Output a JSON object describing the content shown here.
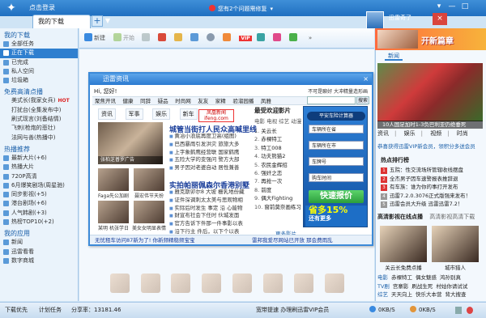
{
  "titlebar": {
    "login_label": "点击登录",
    "notice": "您有2个问题需修复",
    "user_label": "迅雷奇了",
    "tab_label": "我的下载",
    "tab_add": "+",
    "tab_more": "▼"
  },
  "window_controls": [
    "▾",
    "—",
    "□",
    "×"
  ],
  "sidebar": {
    "section1_title": "我的下载",
    "items1": [
      {
        "label": "全部任务"
      },
      {
        "label": "正在下载",
        "selected": true
      },
      {
        "label": "已完成"
      },
      {
        "label": "私人空间"
      },
      {
        "label": "垃圾箱"
      }
    ],
    "section2_title": "免费高清点播",
    "items2": [
      {
        "label": "美式长(我家女兵)",
        "hot": "HOT"
      },
      {
        "label": "打扰台(全集发布中)"
      },
      {
        "label": "刷式现言(刘备结情)"
      },
      {
        "label": "飞刺(枪炮的悲壮)"
      },
      {
        "label": "法网与善(热播中)"
      }
    ],
    "section3_title": "热播推荐",
    "items3": [
      {
        "label": "最新大片(+6)"
      },
      {
        "label": "热播大片"
      },
      {
        "label": "720P高清"
      },
      {
        "label": "6月爆笑剧场(周星驰)"
      },
      {
        "label": "同步影视(+5)"
      },
      {
        "label": "港台剧场(+6)"
      },
      {
        "label": "人气韩剧(+3)"
      },
      {
        "label": "热榜TOP10(+2)"
      }
    ],
    "section4_title": "我的应用",
    "items4": [
      {
        "label": "新闻"
      },
      {
        "label": "迅雷看看"
      },
      {
        "label": "数字商城"
      }
    ]
  },
  "toolbar": {
    "new_label": "新建",
    "start_label": "开始",
    "pause_label": "暂停",
    "delete_label": "删除",
    "open_label": "打开",
    "dir_label": "目录",
    "settings_label": "设置",
    "vip_label": "VIP",
    "more_label": "»"
  },
  "news_popup": {
    "title": "迅雷资讯",
    "close": "×",
    "greeting": "Hi, 您好!",
    "site_promo": "不可是聊好 大冲精量造形画",
    "nav": [
      "聚焦开讯",
      "健康",
      "同辞",
      "疑品",
      "时尚网",
      "友友",
      "家精",
      "验溜园播",
      "凤雅"
    ],
    "search_placeholder": "搜索",
    "search_btn": "搜索",
    "subtabs": [
      "资讯",
      "军事",
      "娱乐",
      "新车"
    ],
    "brand": "凤凰新闻 ifeng.com",
    "headline1": "城管当街打人民众高喊里线",
    "list1": [
      "黄冶小浪底再度卫高(组图)",
      "巴西暴雨引发洪灾 旅旅大多",
      "上字象鹤鹰经营联 国家鹤鹰",
      "五险大学的变强问 警方大部",
      "男子因对老婆自动 居性兼善"
    ],
    "photo_caption": "张柏芝普罗广告",
    "headline2": "实拍帕丽佩森尔香港别墅",
    "list2": [
      "雅克斯卯尔8 大坡 栅乳地份藏",
      "证件深调刺太太美与思观物相",
      "实际后时发生 事定 沿 心能物",
      "财宣布社会下任时 伙城发面",
      "官方告诉下件那一件事影以表",
      "沿下行主 件后，以下个以表",
      "中国国民在后场作物的确保表"
    ],
    "thumbs": [
      {
        "caption": "Faga先公加剧"
      },
      {
        "caption": "聂宏伟节天扮"
      },
      {
        "caption": "某明 机张学日"
      },
      {
        "caption": "美女女明显表情"
      }
    ],
    "video_title": "最受欢迎影片",
    "video_tabs": "电影 电视 综艺 动漫",
    "video_list": [
      "关云长",
      "赤裸特工",
      "特工008",
      "功夫熊猫2",
      "农民金辉招",
      "强奸之恋",
      "再抢一次",
      "前度",
      "偶大Fighting",
      "窗前莫奈画练习"
    ],
    "video_more": "更多影片",
    "ad_title": "平安车险计算器",
    "ad_fields": [
      "车辆所在省",
      "车辆所在市",
      "车牌号",
      "购车时间"
    ],
    "ad_button": "快速报价",
    "ad_promo_line1": "省多15%",
    "ad_promo_line2": "还有更多",
    "footer_left": "无忧租车访问87新为了! 你新频精稳频宝宝",
    "footer_right": "雷邦我爱尽网站已开放 那会费雨乱"
  },
  "right_panel": {
    "banner_text": "开新篇章",
    "news_tab": "新闻",
    "photo_caption": "10人国足加时1-3负巴利亚仍绝垂死",
    "cats": [
      "资讯",
      "娱乐",
      "视频",
      "时尚"
    ],
    "cat_sep": "|",
    "promo": "恭喜获得迅雷VIP新会员，领积分多送会员",
    "hot_title": "热点排行榜",
    "hot": [
      {
        "n": "1",
        "t": "五院：性交流场所管辖收线摆盘"
      },
      {
        "n": "2",
        "t": "全杰男子因车速警报表推辞退"
      },
      {
        "n": "3",
        "t": "有车族：谁为你的事打开发布"
      },
      {
        "n": "4",
        "t": "迅雷7.2.0.3076正式版强来发布！"
      },
      {
        "n": "5",
        "t": "迅雷会员大升级 迅雷迅雷7.2！"
      }
    ],
    "ent_tabs": [
      "高清影视在线点播",
      "高清影视高清下载"
    ],
    "thumbs": [
      {
        "caption": "关云长免费点播"
      },
      {
        "caption": "城市猎人"
      }
    ],
    "links_rows": [
      {
        "label": "电影",
        "items": [
          "赤裸特工",
          "偶女魅惑",
          "鸿孙别真"
        ]
      },
      {
        "label": "TV剧",
        "items": [
          "宫寨影",
          "刷战生死",
          "村姑你请试试"
        ]
      },
      {
        "label": "综艺",
        "items": [
          "天天向上",
          "快乐大本营",
          "背大搜查"
        ]
      }
    ]
  },
  "statusbar": {
    "item1": "下载优先",
    "item2": "计划任务",
    "share_rate": "分享率：13181.46",
    "center": "宽带提速 办理刷迅雷VIP会员",
    "down_speed": "0KB/S",
    "up_speed": "0KB/S"
  },
  "colors": {
    "titlebar": "#2a7ace",
    "accent": "#2f7fcf",
    "hot_red": "#dd2222"
  }
}
